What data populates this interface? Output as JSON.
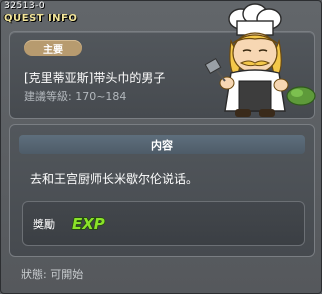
{
  "window": {
    "quest_id": "32513-0",
    "title": "QUEST INFO"
  },
  "quest": {
    "type_badge": "主要",
    "name": "[克里蒂亚斯]带头巾的男子",
    "level_text": "建議等級: 170~184"
  },
  "details": {
    "section_title": "内容",
    "description": "去和王宫厨师长米歇尔伦说话。",
    "reward_label": "獎勵",
    "reward_icon_text": "EXP"
  },
  "status_text": "狀態:  可開始",
  "icons": {
    "npc": "chef-npc-portrait",
    "reward": "exp-reward-icon"
  },
  "colors": {
    "title": "#f2e59a",
    "badge": "#b79b6f",
    "exp": "#8be22a",
    "section_header": "#566674"
  }
}
